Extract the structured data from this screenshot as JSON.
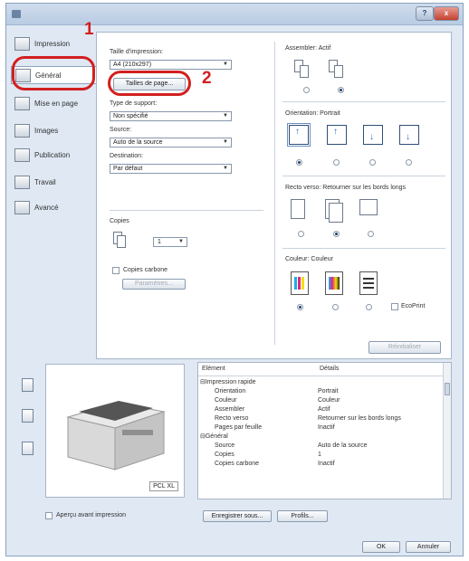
{
  "window": {
    "close_label": "x",
    "help_label": "?"
  },
  "sidebar": {
    "items": [
      {
        "label": "Impression"
      },
      {
        "label": "Général"
      },
      {
        "label": "Mise en page"
      },
      {
        "label": "Images"
      },
      {
        "label": "Publication"
      },
      {
        "label": "Travail"
      },
      {
        "label": "Avancé"
      }
    ]
  },
  "general": {
    "paper_size_label": "Taille d'impression:",
    "paper_size_value": "A4 (210x297)",
    "page_sizes_button": "Tailles de page...",
    "media_label": "Type de support:",
    "media_value": "Non spécifié",
    "source_label": "Source:",
    "source_value": "Auto de la source",
    "destination_label": "Destination:",
    "destination_value": "Par défaut",
    "copies_label": "Copies",
    "copies_value": "1",
    "carbon_copies_label": "Copies carbone",
    "parameters_button": "Paramètres...",
    "collate_label": "Assembler: Actif",
    "orientation_label": "Orientation: Portrait",
    "duplex_label": "Recto verso: Retourner sur les bords longs",
    "color_label": "Couleur: Couleur",
    "ecoprint_label": "EcoPrint",
    "reset_button": "Réinitialiser"
  },
  "callouts": {
    "one": "1",
    "two": "2"
  },
  "preview": {
    "model_label": "PCL XL"
  },
  "summary": {
    "col_element": "Elément",
    "col_details": "Détails",
    "rows": [
      {
        "el": "⊟Impression rapide",
        "val": ""
      },
      {
        "el": "Orientation",
        "val": "Portrait"
      },
      {
        "el": "Couleur",
        "val": "Couleur"
      },
      {
        "el": "Assembler",
        "val": "Actif"
      },
      {
        "el": "Recto verso",
        "val": "Retourner sur les bords longs"
      },
      {
        "el": "Pages par feuille",
        "val": "Inactif"
      },
      {
        "el": "⊟Général",
        "val": ""
      },
      {
        "el": "Source",
        "val": "Auto de la source"
      },
      {
        "el": "Copies",
        "val": "1"
      },
      {
        "el": "Copies carbone",
        "val": "Inactif"
      }
    ]
  },
  "footer": {
    "preview_checkbox_label": "Aperçu avant impression",
    "save_as_button": "Enregistrer sous...",
    "profiles_button": "Profils...",
    "ok_button": "OK",
    "cancel_button": "Annuler"
  }
}
